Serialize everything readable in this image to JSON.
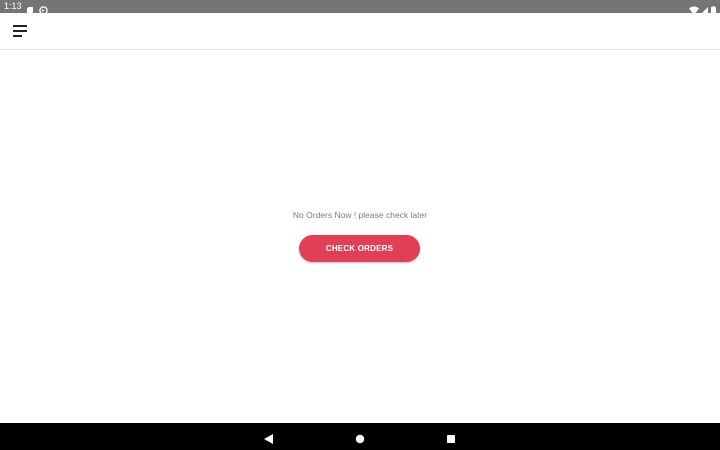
{
  "status_bar": {
    "time": "1:13",
    "icons": [
      "sd-card-icon",
      "sync-icon",
      "wifi-icon",
      "signal-icon",
      "battery-icon"
    ]
  },
  "app_bar": {
    "menu_icon": "menu-icon"
  },
  "main": {
    "empty_message": "No Orders Now ! please check later",
    "check_orders_label": "CHECK ORDERS"
  },
  "nav_bar": {
    "buttons": [
      "back-icon",
      "home-icon",
      "recents-icon"
    ]
  },
  "colors": {
    "accent": "#e03f58",
    "status_bar": "#757575",
    "nav_bar": "#000000",
    "message_text": "#7d7d7d"
  }
}
